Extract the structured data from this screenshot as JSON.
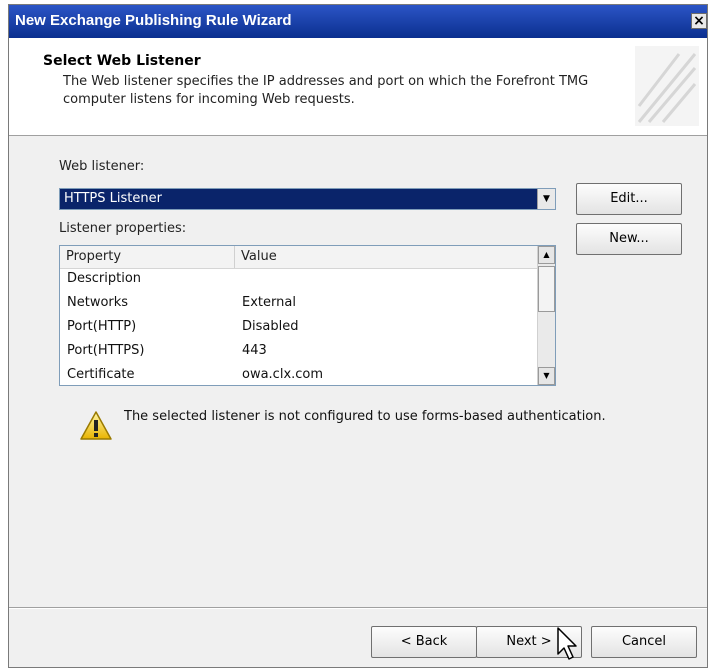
{
  "window": {
    "title": "New Exchange Publishing Rule Wizard",
    "close_label": "×"
  },
  "header": {
    "title": "Select Web Listener",
    "description": "The Web listener specifies the IP addresses and port on which the Forefront TMG computer listens for incoming Web requests."
  },
  "web_listener": {
    "label": "Web listener:",
    "selected": "HTTPS Listener"
  },
  "buttons": {
    "edit": "Edit...",
    "new": "New..."
  },
  "listener_properties": {
    "label": "Listener properties:",
    "columns": [
      "Property",
      "Value"
    ],
    "rows": [
      {
        "property": "Description",
        "value": ""
      },
      {
        "property": "Networks",
        "value": "External"
      },
      {
        "property": "Port(HTTP)",
        "value": "Disabled"
      },
      {
        "property": "Port(HTTPS)",
        "value": "443"
      },
      {
        "property": "Certificate",
        "value": "owa.clx.com"
      }
    ]
  },
  "warning": {
    "text": "The selected listener is not configured to use forms-based authentication."
  },
  "footer": {
    "back": "< Back",
    "next": "Next >",
    "cancel": "Cancel"
  },
  "icons": {
    "warning": "warning-icon",
    "close": "close-icon",
    "dropdown": "chevron-down-icon"
  }
}
